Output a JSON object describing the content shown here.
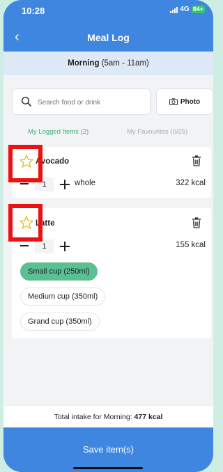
{
  "status": {
    "time": "10:28",
    "network": "4G",
    "battery": "84+"
  },
  "header": {
    "title": "Meal Log"
  },
  "period": {
    "name": "Morning",
    "range": "(5am - 11am)"
  },
  "search": {
    "placeholder": "Search food or drink"
  },
  "photo_label": "Photo",
  "tabs": [
    {
      "label": "My Logged Items (2)"
    },
    {
      "label": "My Favourites (0/25)"
    }
  ],
  "items": [
    {
      "name": "Avocado",
      "qty": "1",
      "unit": "whole",
      "kcal": "322 kcal"
    },
    {
      "name": "Latte",
      "qty": "1",
      "unit": "",
      "kcal": "155 kcal",
      "options": [
        "Small cup (250ml)",
        "Medium cup (350ml)",
        "Grand cup (350ml)"
      ],
      "selected_option": "Small cup (250ml)"
    }
  ],
  "total": {
    "prefix": "Total intake for Morning: ",
    "value": "477 kcal"
  },
  "save_label": "Save item(s)",
  "colors": {
    "primary": "#3f86e0",
    "accent": "#3daf7a",
    "selected_pill": "#5cbf8f",
    "highlight": "#ee1111"
  }
}
